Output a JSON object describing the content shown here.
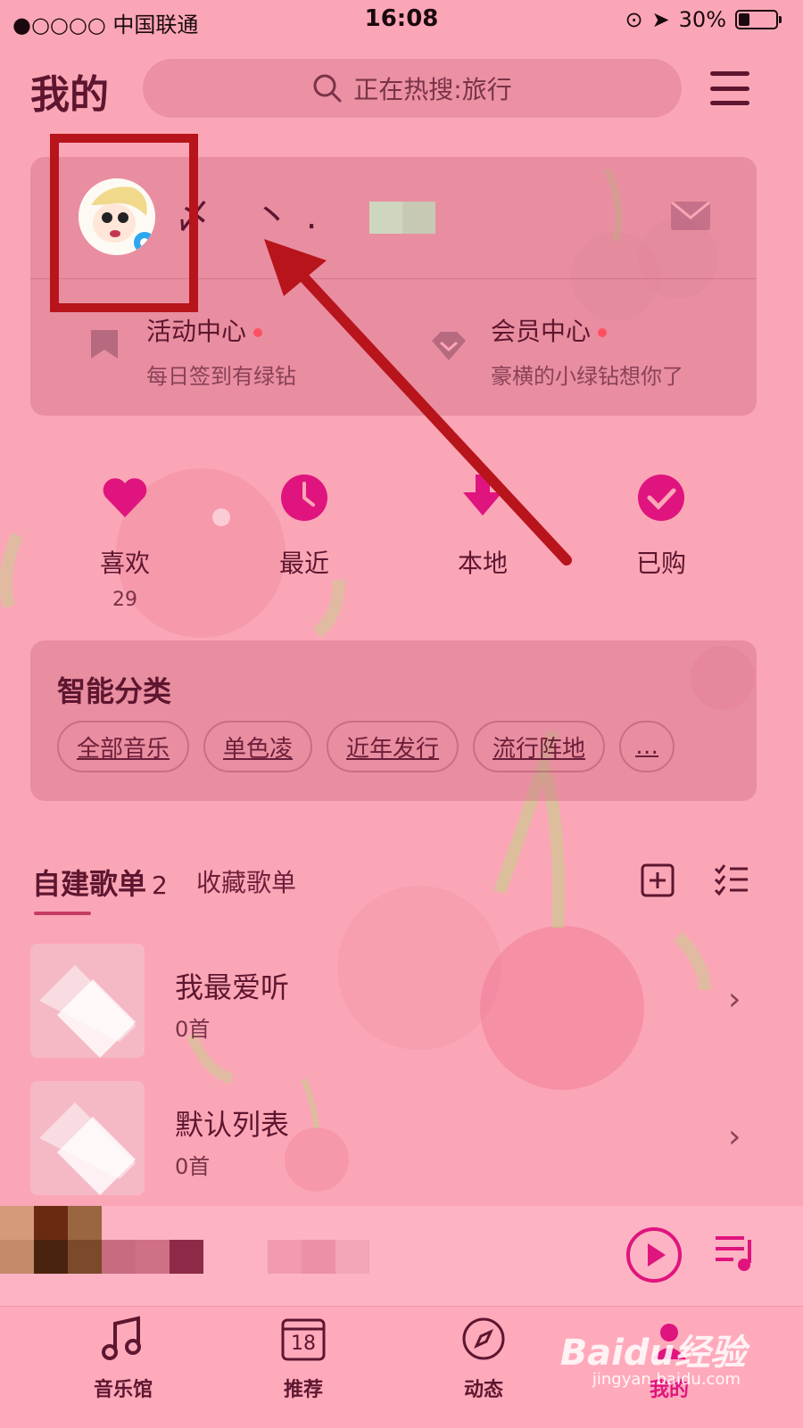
{
  "status_bar": {
    "carrier": "●○○○○ 中国联通",
    "time": "16:08",
    "battery": "30%"
  },
  "header": {
    "title": "我的",
    "search_placeholder": "正在热搜:旅行"
  },
  "profile": {
    "nickname": "〆 丶."
  },
  "features": [
    {
      "title": "活动中心",
      "subtitle": "每日签到有绿钻"
    },
    {
      "title": "会员中心",
      "subtitle": "豪横的小绿钻想你了"
    }
  ],
  "quick_actions": [
    {
      "label": "喜欢",
      "count": "29"
    },
    {
      "label": "最近"
    },
    {
      "label": "本地"
    },
    {
      "label": "已购"
    }
  ],
  "smart_category": {
    "title": "智能分类",
    "chips": [
      "全部音乐",
      "单色凌",
      "近年发行",
      "流行阵地",
      "…"
    ]
  },
  "playlist_tabs": {
    "created_label": "自建歌单",
    "created_count": "2",
    "collected_label": "收藏歌单"
  },
  "playlists": [
    {
      "name": "我最爱听",
      "count": "0首"
    },
    {
      "name": "默认列表",
      "count": "0首"
    }
  ],
  "bottom_nav": [
    {
      "label": "音乐馆"
    },
    {
      "label": "推荐",
      "badge": "18"
    },
    {
      "label": "动态"
    },
    {
      "label": "我的"
    }
  ],
  "watermark": {
    "brand": "Baidu经验",
    "url": "jingyan.baidu.com"
  },
  "colors": {
    "background": "#fba6b6",
    "accent": "#e0147e",
    "text": "#5e1630",
    "annotation": "#b8141c"
  }
}
